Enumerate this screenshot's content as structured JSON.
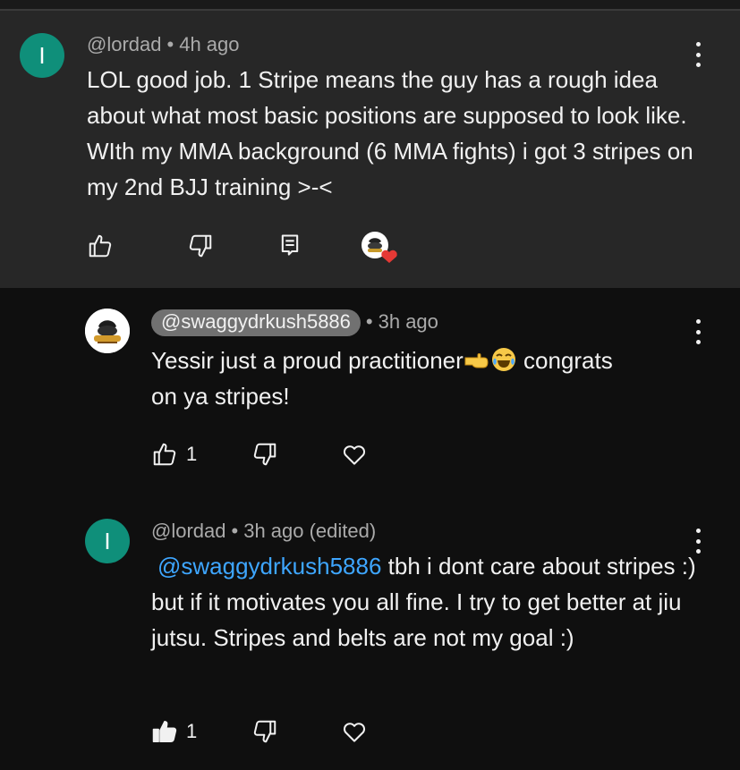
{
  "comments": [
    {
      "avatar_letter": "I",
      "author": "@lordad",
      "separator": "•",
      "time": "4h ago",
      "text": "LOL good job.  1 Stripe means the guy has a rough idea about what most basic positions are supposed to look like. WIth my MMA background (6 MMA fights) i got 3 stripes on my 2nd BJJ training >-<",
      "actions": [
        "thumbs-up-icon",
        "thumbs-down-icon",
        "reply-icon",
        "creator-heart-icon"
      ]
    },
    {
      "author": "@swaggydrkush5886",
      "separator": "•",
      "time": "3h ago",
      "text_before_emoji": "Yessir just a proud practitioner",
      "emojis": [
        "pointing-hand-emoji",
        "tears-of-joy-emoji"
      ],
      "text_after_emoji_line1": " congrats",
      "text_line2": "on ya stripes!",
      "like_count": "1",
      "actions": [
        "thumbs-up-icon",
        "thumbs-down-icon",
        "heart-icon"
      ]
    },
    {
      "avatar_letter": "I",
      "author": "@lordad",
      "separator": "•",
      "time": "3h ago (edited)",
      "mention": "@swaggydrkush5886",
      "text": " tbh i dont care about stripes :) but if it motivates you all fine. I try to get better at jiu jutsu. Stripes and belts are not my goal :)",
      "like_count": "1",
      "liked": true,
      "actions": [
        "thumbs-up-filled-icon",
        "thumbs-down-icon",
        "heart-icon"
      ]
    }
  ],
  "colors": {
    "background": "#0f0f0f",
    "highlight": "#272727",
    "avatar": "#0f8f7a",
    "mention": "#3ea6ff",
    "meta": "#aaaaaa",
    "heart": "#e53935"
  }
}
